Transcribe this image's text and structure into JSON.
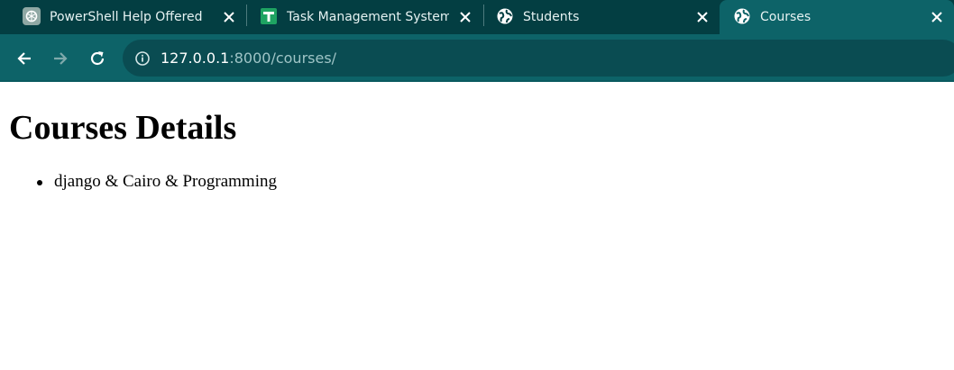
{
  "browser": {
    "tabs": [
      {
        "title": "PowerShell Help Offered",
        "favicon": "chatgpt-icon",
        "active": false
      },
      {
        "title": "Task Management System -",
        "favicon": "google-sheets-icon",
        "active": false
      },
      {
        "title": "Students",
        "favicon": "globe-icon",
        "active": false
      },
      {
        "title": "Courses",
        "favicon": "globe-icon",
        "active": true
      }
    ],
    "address": {
      "host": "127.0.0.1",
      "path": ":8000/courses/"
    },
    "colors": {
      "tabstrip": "#033e42",
      "toolbar": "#0d6368",
      "omnibox": "#0a4c52"
    }
  },
  "page": {
    "heading": "Courses Details",
    "courses": [
      "django & Cairo & Programming"
    ]
  }
}
